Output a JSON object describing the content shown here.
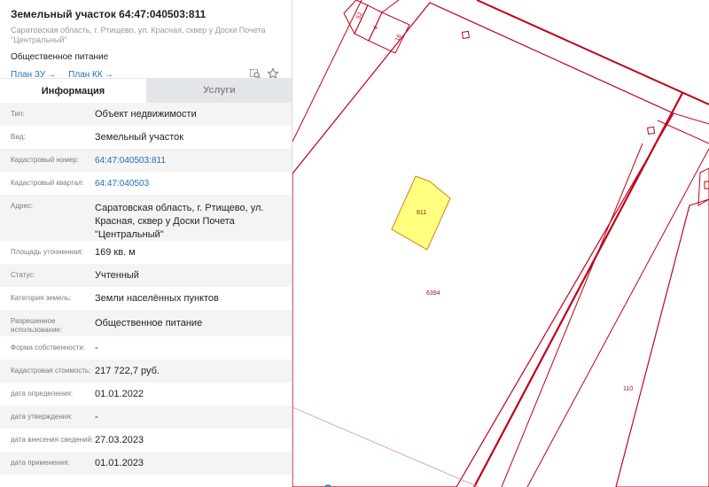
{
  "header": {
    "title": "Земельный участок 64:47:040503:811",
    "address_line1": "Саратовская область, г. Ртищево, ул. Красная, сквер у Доски Почета",
    "address_line2": "\"Центральный\"",
    "purpose": "Общественное питание",
    "link_zu": "План ЗУ",
    "link_kk": "План КК",
    "arrow": "→",
    "icons": [
      "search-area-icon",
      "star-icon"
    ]
  },
  "tabs": [
    {
      "label": "Информация",
      "active": true
    },
    {
      "label": "Услуги",
      "active": false
    }
  ],
  "rows": [
    {
      "key": "Тип:",
      "value": "Объект недвижимости",
      "link": false
    },
    {
      "key": "Вид:",
      "value": "Земельный участок",
      "link": false
    },
    {
      "key": "Кадастровый номер:",
      "value": "64:47:040503:811",
      "link": true
    },
    {
      "key": "Кадастровый квартал:",
      "value": "64:47:040503",
      "link": true
    },
    {
      "key": "Адрес:",
      "value": "Саратовская область, г. Ртищево, ул. Красная, сквер у Доски Почета \"Центральный\"",
      "link": false
    },
    {
      "key": "Площадь уточненная:",
      "value": "169 кв. м",
      "link": false
    },
    {
      "key": "Статус:",
      "value": "Учтенный",
      "link": false
    },
    {
      "key": "Категория земель:",
      "value": "Земли населённых пунктов",
      "link": false
    },
    {
      "key": "Разрешенное использование:",
      "value": "Общественное питание",
      "link": false
    },
    {
      "key": "Форма собственности:",
      "value": "-",
      "link": false
    },
    {
      "key": "Кадастровая стоимость:",
      "value": "217 722,7 руб.",
      "link": false
    },
    {
      "key": "дата определения:",
      "value": "01.01.2022",
      "link": false
    },
    {
      "key": "дата утверждения:",
      "value": "-",
      "link": false
    },
    {
      "key": "дата внесения сведений:",
      "value": "27.03.2023",
      "link": false
    },
    {
      "key": "дата применения:",
      "value": "01.01.2023",
      "link": false
    }
  ],
  "map": {
    "parcel_labels": [
      "52",
      "4",
      "16",
      "811",
      "6394",
      "110"
    ],
    "colors": {
      "boundary": "#c0001a",
      "highlight_fill": "#ffff80",
      "highlight_stroke": "#d08020"
    }
  }
}
